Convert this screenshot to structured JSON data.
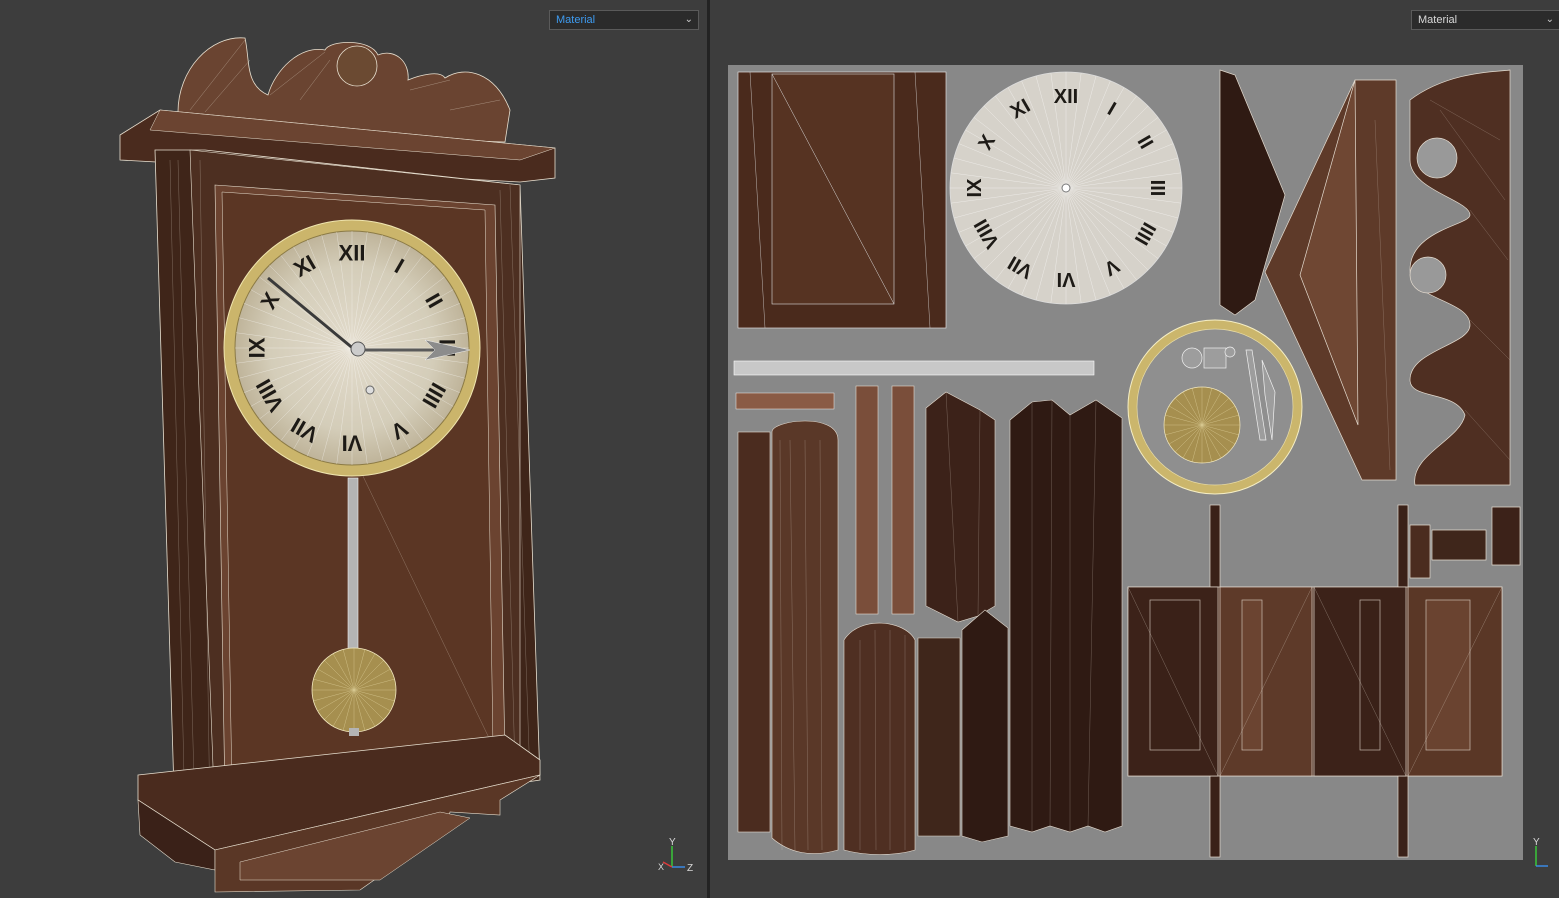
{
  "left_viewport": {
    "material_label": "Material",
    "axis_labels": {
      "y": "Y",
      "x": "X",
      "z": "Z"
    }
  },
  "right_viewport": {
    "material_label": "Material",
    "axis_labels": {
      "y": "Y"
    }
  },
  "clock_numerals": [
    "XII",
    "I",
    "II",
    "III",
    "IIII",
    "V",
    "VI",
    "VII",
    "VIII",
    "IX",
    "X",
    "XI"
  ],
  "colors": {
    "background": "#3d3d3d",
    "uv_canvas": "#888888",
    "wood_dark": "#3a2118",
    "wood_mid": "#5e3a29",
    "wood_light": "#7a4e36",
    "brass": "#c9b46a",
    "dial": "#d9d6cf",
    "accent_blue": "#3e9bf0",
    "gizmo_green": "#3ad13a"
  },
  "icons": {
    "dropdown": "chevron-down-icon",
    "axis_gizmo": "axis-gizmo-icon"
  }
}
